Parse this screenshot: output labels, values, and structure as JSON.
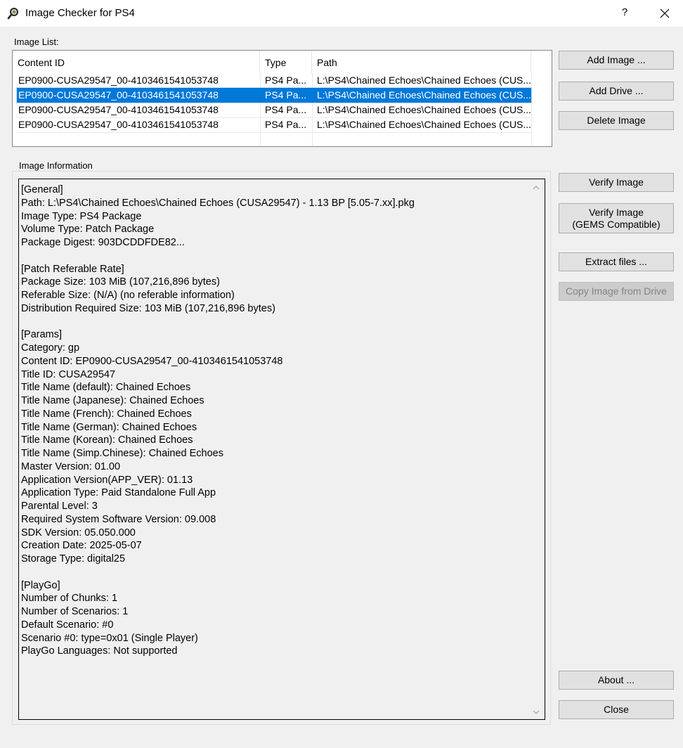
{
  "window": {
    "title": "Image Checker for PS4",
    "help_glyph": "?"
  },
  "image_list": {
    "label": "Image List:",
    "columns": [
      "Content ID",
      "Type",
      "Path"
    ],
    "rows": [
      [
        "EP0900-CUSA29547_00-4103461541053748",
        "PS4 Pa...",
        "L:\\PS4\\Chained Echoes\\Chained Echoes (CUS..."
      ],
      [
        "EP0900-CUSA29547_00-4103461541053748",
        "PS4 Pa...",
        "L:\\PS4\\Chained Echoes\\Chained Echoes (CUS..."
      ],
      [
        "EP0900-CUSA29547_00-4103461541053748",
        "PS4 Pa...",
        "L:\\PS4\\Chained Echoes\\Chained Echoes (CUS..."
      ],
      [
        "EP0900-CUSA29547_00-4103461541053748",
        "PS4 Pa...",
        "L:\\PS4\\Chained Echoes\\Chained Echoes (CUS..."
      ]
    ],
    "selected_row": 1
  },
  "image_information": {
    "label": "Image Information",
    "text": "[General]\nPath: L:\\PS4\\Chained Echoes\\Chained Echoes (CUSA29547) - 1.13 BP [5.05-7.xx].pkg\nImage Type: PS4 Package\nVolume Type: Patch Package\nPackage Digest: 903DCDDFDE82...\n\n[Patch Referable Rate]\nPackage Size: 103 MiB (107,216,896 bytes)\nReferable Size: (N/A) (no referable information)\nDistribution Required Size: 103 MiB (107,216,896 bytes)\n\n[Params]\nCategory: gp\nContent ID: EP0900-CUSA29547_00-4103461541053748\nTitle ID: CUSA29547\nTitle Name (default): Chained Echoes\nTitle Name (Japanese): Chained Echoes\nTitle Name (French): Chained Echoes\nTitle Name (German): Chained Echoes\nTitle Name (Korean): Chained Echoes\nTitle Name (Simp.Chinese): Chained Echoes\nMaster Version: 01.00\nApplication Version(APP_VER): 01.13\nApplication Type: Paid Standalone Full App\nParental Level: 3\nRequired System Software Version: 09.008\nSDK Version: 05.050.000\nCreation Date: 2025-05-07\nStorage Type: digital25\n\n[PlayGo]\nNumber of Chunks: 1\nNumber of Scenarios: 1\nDefault Scenario: #0\nScenario #0: type=0x01 (Single Player)\nPlayGo Languages: Not supported"
  },
  "buttons": {
    "add_image": "Add Image ...",
    "add_drive": "Add Drive ...",
    "delete_image": "Delete Image",
    "verify_image": "Verify Image",
    "verify_image_gems_line1": "Verify Image",
    "verify_image_gems_line2": "(GEMS Compatible)",
    "extract_files": "Extract files ...",
    "copy_image_from_drive": "Copy Image from Drive",
    "about": "About ...",
    "close": "Close"
  }
}
